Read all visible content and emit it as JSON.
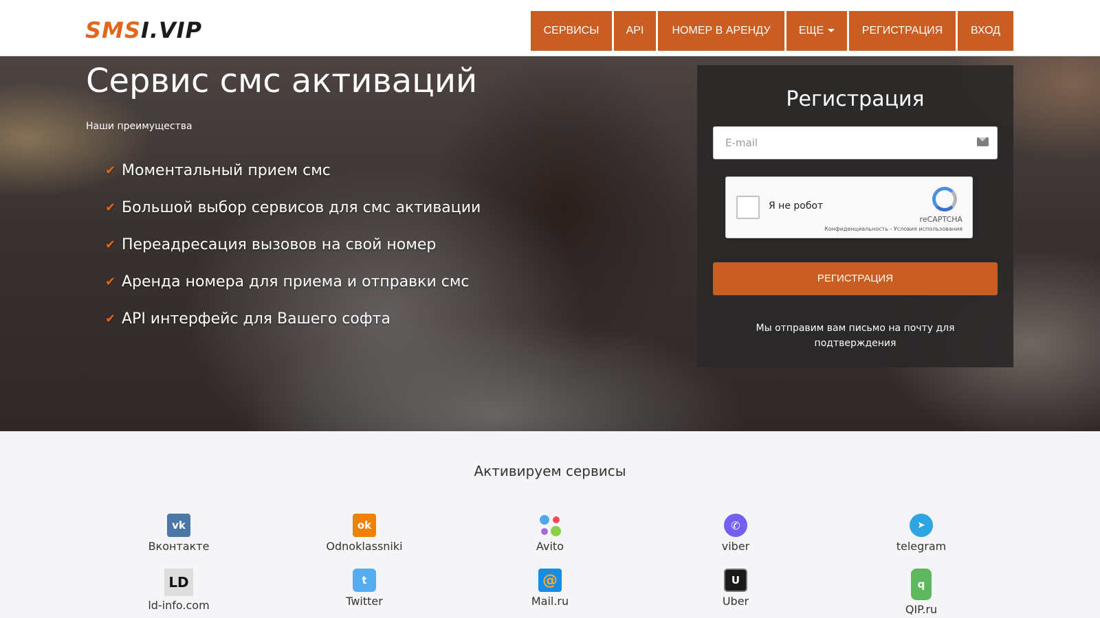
{
  "header": {
    "logo_part1": "SMS",
    "logo_part2": "I.VIP",
    "nav": [
      {
        "label": "СЕРВИСЫ"
      },
      {
        "label": "API"
      },
      {
        "label": "НОМЕР В АРЕНДУ"
      },
      {
        "label": "ЕЩЕ"
      },
      {
        "label": "РЕГИСТРАЦИЯ"
      },
      {
        "label": "ВХОД"
      }
    ]
  },
  "hero": {
    "title": "Сервис смс активаций",
    "subtitle": "Наши преимущества",
    "features": [
      "Моментальный прием смс",
      "Большой выбор сервисов для смс активации",
      "Переадресация вызовов на свой номер",
      "Аренда номера для приема и отправки смс",
      "API интерфейс для Вашего софта"
    ]
  },
  "registration": {
    "title": "Регистрация",
    "email_placeholder": "E-mail",
    "email_value": "",
    "captcha_label": "Я не робот",
    "captcha_brand": "reCAPTCHA",
    "captcha_links": "Конфиденциальность - Условия использования",
    "captcha_checked": false,
    "button_label": "РЕГИСТРАЦИЯ",
    "note": "Мы отправим вам письмо на почту для подтверждения"
  },
  "services": {
    "title": "Активируем сервисы",
    "items": [
      {
        "label": "Вконтакте",
        "icon": "vk-icon",
        "color": "#4a76a8"
      },
      {
        "label": "Odnoklassniki",
        "icon": "odnoklassniki-icon",
        "color": "#ee8208"
      },
      {
        "label": "Avito",
        "icon": "avito-icon",
        "color": "#ffffff"
      },
      {
        "label": "viber",
        "icon": "viber-icon",
        "color": "#7360f2"
      },
      {
        "label": "telegram",
        "icon": "telegram-icon",
        "color": "#2ca5e0"
      },
      {
        "label": "ld-info.com",
        "icon": "ld-info-icon",
        "color": "#dddddd"
      },
      {
        "label": "Twitter",
        "icon": "twitter-icon",
        "color": "#55acee"
      },
      {
        "label": "Mail.ru",
        "icon": "mailru-icon",
        "color": "#168de2"
      },
      {
        "label": "Uber",
        "icon": "uber-icon",
        "color": "#000000"
      },
      {
        "label": "QIP.ru",
        "icon": "qip-icon",
        "color": "#5fb75f"
      }
    ]
  },
  "colors": {
    "accent": "#c95d22",
    "logo_orange": "#e2661e",
    "panel_bg": "#2a2828",
    "section_bg": "#f5f4f7"
  }
}
